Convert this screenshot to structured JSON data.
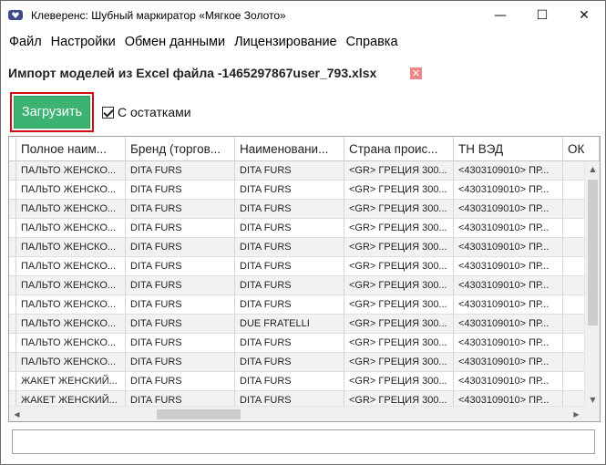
{
  "window": {
    "title": "Клеверенс: Шубный маркиратор «Мягкое Золото»",
    "controls": {
      "minimize": "—",
      "maximize": "☐",
      "close": "✕"
    }
  },
  "menu": [
    "Файл",
    "Настройки",
    "Обмен данными",
    "Лицензирование",
    "Справка"
  ],
  "import": {
    "title": "Импорт моделей из Excel файла -1465297867user_793.xlsx",
    "close_icon": "✕"
  },
  "toolbar": {
    "load_label": "Загрузить",
    "with_stock_label": "С остатками",
    "with_stock_checked": true
  },
  "grid": {
    "columns": [
      "",
      "Полное наим...",
      "Бренд (торгов...",
      "Наименовани...",
      "Страна проис...",
      "ТН ВЭД",
      "ОК"
    ],
    "rows": [
      [
        "",
        "ПАЛЬТО ЖЕНСКО...",
        "DITA FURS",
        "DITA FURS",
        "<GR> ГРЕЦИЯ 300...",
        "<4303109010> ПР...",
        ""
      ],
      [
        "",
        "ПАЛЬТО ЖЕНСКО...",
        "DITA FURS",
        "DITA FURS",
        "<GR> ГРЕЦИЯ 300...",
        "<4303109010> ПР...",
        ""
      ],
      [
        "",
        "ПАЛЬТО ЖЕНСКО...",
        "DITA FURS",
        "DITA FURS",
        "<GR> ГРЕЦИЯ 300...",
        "<4303109010> ПР...",
        ""
      ],
      [
        "",
        "ПАЛЬТО ЖЕНСКО...",
        "DITA FURS",
        "DITA FURS",
        "<GR> ГРЕЦИЯ 300...",
        "<4303109010> ПР...",
        ""
      ],
      [
        "",
        "ПАЛЬТО ЖЕНСКО...",
        "DITA FURS",
        "DITA FURS",
        "<GR> ГРЕЦИЯ 300...",
        "<4303109010> ПР...",
        ""
      ],
      [
        "",
        "ПАЛЬТО ЖЕНСКО...",
        "DITA FURS",
        "DITA FURS",
        "<GR> ГРЕЦИЯ 300...",
        "<4303109010> ПР...",
        ""
      ],
      [
        "",
        "ПАЛЬТО ЖЕНСКО...",
        "DITA FURS",
        "DITA FURS",
        "<GR> ГРЕЦИЯ 300...",
        "<4303109010> ПР...",
        ""
      ],
      [
        "",
        "ПАЛЬТО ЖЕНСКО...",
        "DITA FURS",
        "DITA FURS",
        "<GR> ГРЕЦИЯ 300...",
        "<4303109010> ПР...",
        ""
      ],
      [
        "",
        "ПАЛЬТО ЖЕНСКО...",
        "DITA FURS",
        "DUE FRATELLI",
        "<GR> ГРЕЦИЯ 300...",
        "<4303109010> ПР...",
        ""
      ],
      [
        "",
        "ПАЛЬТО ЖЕНСКО...",
        "DITA FURS",
        "DITA FURS",
        "<GR> ГРЕЦИЯ 300...",
        "<4303109010> ПР...",
        ""
      ],
      [
        "",
        "ПАЛЬТО ЖЕНСКО...",
        "DITA FURS",
        "DITA FURS",
        "<GR> ГРЕЦИЯ 300...",
        "<4303109010> ПР...",
        ""
      ],
      [
        "",
        "ЖАКЕТ ЖЕНСКИЙ...",
        "DITA FURS",
        "DITA FURS",
        "<GR> ГРЕЦИЯ 300...",
        "<4303109010> ПР...",
        ""
      ],
      [
        "",
        "ЖАКЕТ ЖЕНСКИЙ...",
        "DITA FURS",
        "DITA FURS",
        "<GR> ГРЕЦИЯ 300...",
        "<4303109010> ПР...",
        ""
      ]
    ]
  },
  "scrollbars": {
    "up": "▲",
    "down": "▼",
    "left": "◀",
    "right": "▶"
  },
  "status": {
    "text": ""
  }
}
